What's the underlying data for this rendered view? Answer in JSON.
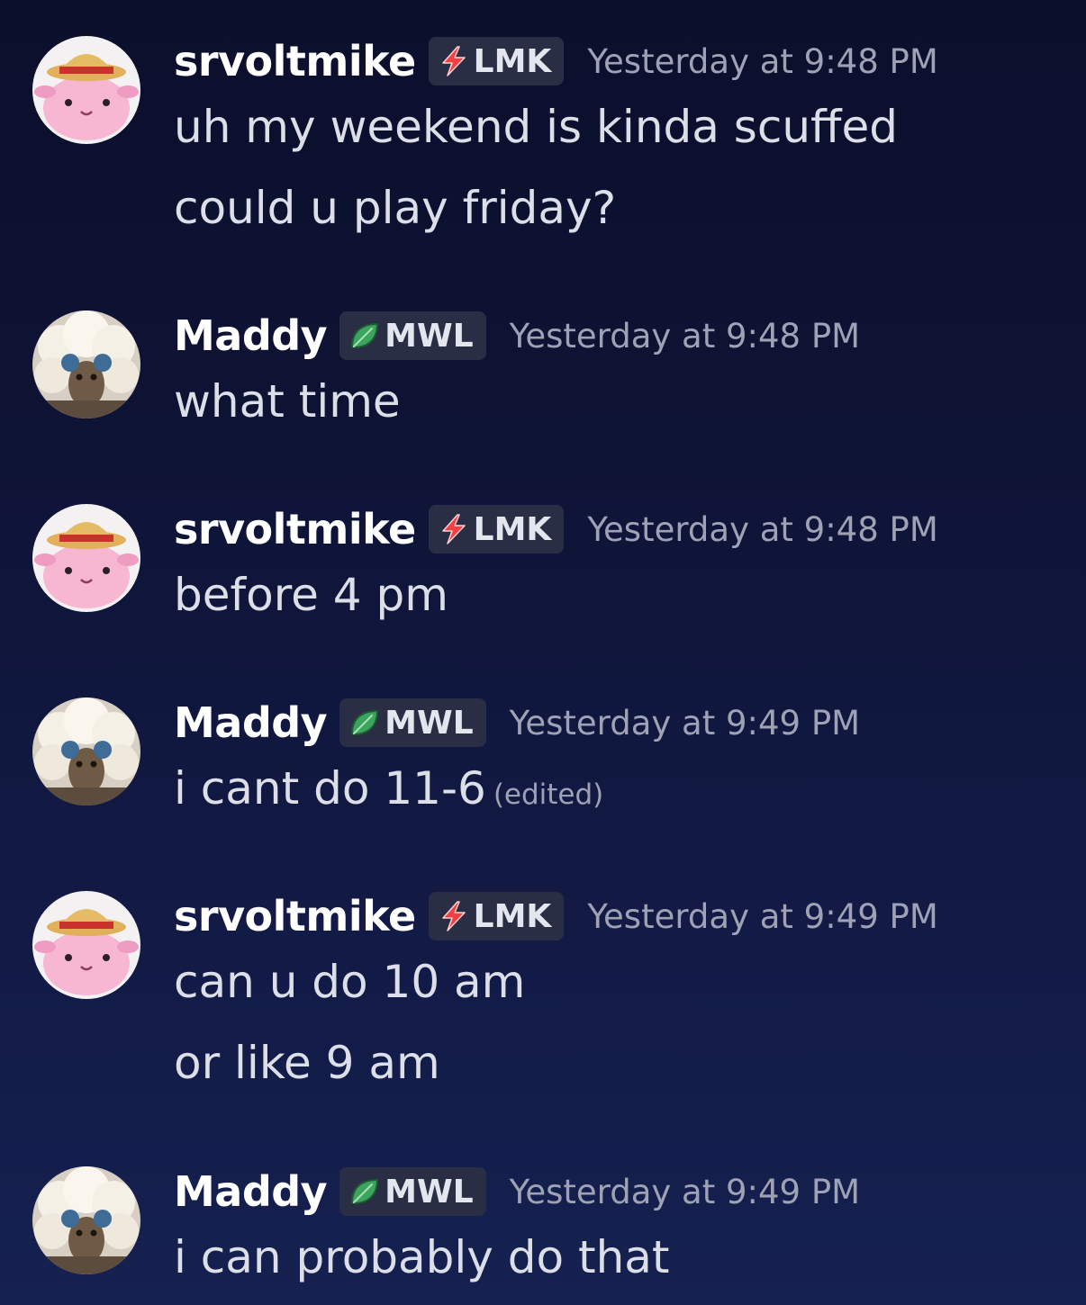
{
  "messages": [
    {
      "author": "srvoltmike",
      "tag": {
        "icon": "lightning-bolt-icon",
        "text": "LMK"
      },
      "timestamp": "Yesterday at 9:48 PM",
      "lines": [
        "uh my weekend is kinda scuffed",
        "could u play friday?"
      ]
    },
    {
      "author": "Maddy",
      "tag": {
        "icon": "leaf-icon",
        "text": "MWL"
      },
      "timestamp": "Yesterday at 9:48 PM",
      "lines": [
        "what time"
      ]
    },
    {
      "author": "srvoltmike",
      "tag": {
        "icon": "lightning-bolt-icon",
        "text": "LMK"
      },
      "timestamp": "Yesterday at 9:48 PM",
      "lines": [
        "before 4 pm"
      ]
    },
    {
      "author": "Maddy",
      "tag": {
        "icon": "leaf-icon",
        "text": "MWL"
      },
      "timestamp": "Yesterday at 9:49 PM",
      "lines": [
        "i cant do 11-6"
      ],
      "edited_label": "(edited)"
    },
    {
      "author": "srvoltmike",
      "tag": {
        "icon": "lightning-bolt-icon",
        "text": "LMK"
      },
      "timestamp": "Yesterday at 9:49 PM",
      "lines": [
        "can u do 10 am",
        "or like 9 am"
      ]
    },
    {
      "author": "Maddy",
      "tag": {
        "icon": "leaf-icon",
        "text": "MWL"
      },
      "timestamp": "Yesterday at 9:49 PM",
      "lines": [
        "i can probably do that"
      ]
    }
  ],
  "colors": {
    "background_top": "#0b0f2c",
    "background_bottom": "#152150",
    "username": "#ffffff",
    "message_text": "#dcdfe7",
    "timestamp": "#9ea2b4",
    "tag_background": "#2a2e45",
    "lightning_icon": "#f23f43",
    "leaf_icon": "#3ba55d"
  }
}
